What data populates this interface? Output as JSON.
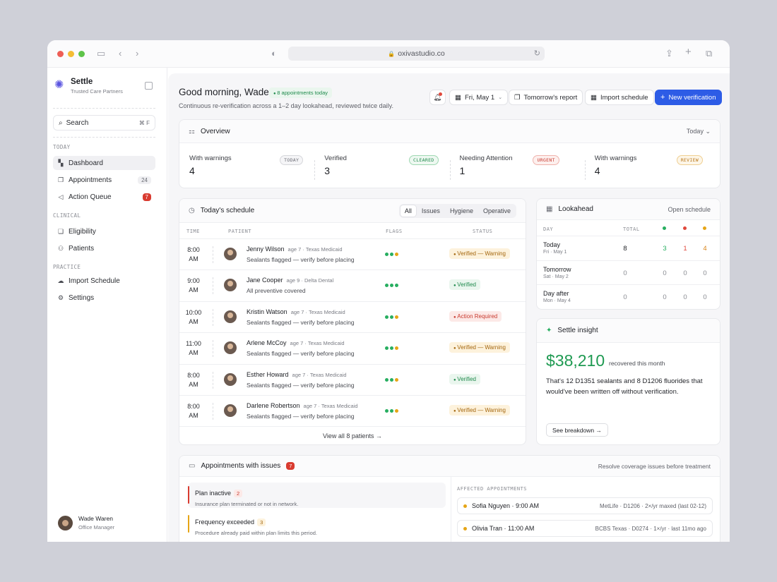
{
  "browser": {
    "url": "oxivastudio.co"
  },
  "sidebar": {
    "brand_name": "Settle",
    "brand_sub": "Trusted Care Partners",
    "search_label": "Search",
    "search_kbd": "⌘ F",
    "sections": {
      "today": "TODAY",
      "clinical": "CLINICAL",
      "practice": "PRACTICE"
    },
    "items": [
      {
        "label": "Dashboard"
      },
      {
        "label": "Appointments",
        "count": "24"
      },
      {
        "label": "Action Queue",
        "count": "7"
      },
      {
        "label": "Eligibility"
      },
      {
        "label": "Patients"
      },
      {
        "label": "Import Schedule"
      },
      {
        "label": "Settings"
      }
    ],
    "user": {
      "name": "Wade Waren",
      "role": "Office Manager"
    }
  },
  "header": {
    "greeting": "Good morning, Wade",
    "badge": "8 appointments today",
    "subtitle": "Continuous re-verification across a 1–2 day lookahead, reviewed twice daily.",
    "date_label": "Fri, May 1",
    "report_label": "Tomorrow's report",
    "import_label": "Import schedule",
    "new_label": "New verification"
  },
  "overview": {
    "title": "Overview",
    "range": "Today",
    "stats": [
      {
        "label": "With warnings",
        "value": "4",
        "tag": "TODAY"
      },
      {
        "label": "Verified",
        "value": "3",
        "tag": "CLEARED"
      },
      {
        "label": "Needing Attention",
        "value": "1",
        "tag": "URGENT"
      },
      {
        "label": "With warnings",
        "value": "4",
        "tag": "REVIEW"
      }
    ]
  },
  "schedule": {
    "title": "Today's schedule",
    "filters": [
      "All",
      "Issues",
      "Hygiene",
      "Operative"
    ],
    "cols": {
      "time": "TIME",
      "patient": "PATIENT",
      "flags": "FLAGS",
      "status": "STATUS"
    },
    "rows": [
      {
        "time": "8:00",
        "ampm": "AM",
        "name": "Jenny Wilson",
        "meta": "age 7 · Texas Medicaid",
        "desc": "Sealants flagged — verify before placing",
        "status": "Verified — Warning"
      },
      {
        "time": "9:00",
        "ampm": "AM",
        "name": "Jane Cooper",
        "meta": "age 9 · Delta Dental",
        "desc": "All preventive covered",
        "status": "Verified"
      },
      {
        "time": "10:00",
        "ampm": "AM",
        "name": "Kristin Watson",
        "meta": "age 7 · Texas Medicaid",
        "desc": "Sealants flagged — verify before placing",
        "status": "Action Required"
      },
      {
        "time": "11:00",
        "ampm": "AM",
        "name": "Arlene McCoy",
        "meta": "age 7 · Texas Medicaid",
        "desc": "Sealants flagged — verify before placing",
        "status": "Verified — Warning"
      },
      {
        "time": "8:00",
        "ampm": "AM",
        "name": "Esther Howard",
        "meta": "age 7 · Texas Medicaid",
        "desc": "Sealants flagged — verify before placing",
        "status": "Verified"
      },
      {
        "time": "8:00",
        "ampm": "AM",
        "name": "Darlene Robertson",
        "meta": "age 7 · Texas Medicaid",
        "desc": "Sealants flagged — verify before placing",
        "status": "Verified — Warning"
      }
    ],
    "view_all": "View all 8 patients →"
  },
  "lookahead": {
    "title": "Lookahead",
    "action": "Open schedule",
    "cols": {
      "day": "DAY",
      "total": "TOTAL"
    },
    "rows": [
      {
        "day": "Today",
        "date": "Fri · May 1",
        "total": "8",
        "green": "3",
        "red": "1",
        "amber": "4"
      },
      {
        "day": "Tomorrow",
        "date": "Sat · May 2",
        "total": "0",
        "green": "0",
        "red": "0",
        "amber": "0"
      },
      {
        "day": "Day after",
        "date": "Mon · May 4",
        "total": "0",
        "green": "0",
        "red": "0",
        "amber": "0"
      }
    ]
  },
  "insight": {
    "title": "Settle insight",
    "amount": "$38,210",
    "amount_sub": "recovered this month",
    "text_pre": "That's ",
    "text_a": "12 D1351 sealants",
    "text_mid": " and ",
    "text_b": "8 D1206 fluorides",
    "text_post": " that would've been written off without verification.",
    "button": "See breakdown →"
  },
  "issues": {
    "title": "Appointments with issues",
    "count": "7",
    "right_text": "Resolve coverage issues before treatment",
    "affected_label": "AFFECTED APPOINTMENTS",
    "items": [
      {
        "title": "Plan inactive",
        "count": "2",
        "desc": "Insurance plan terminated or not in network."
      },
      {
        "title": "Frequency exceeded",
        "count": "3",
        "desc": "Procedure already paid within plan limits this period."
      }
    ],
    "affected": [
      {
        "name": "Sofia Nguyen · 9:00 AM",
        "detail": "MetLife · D1206 · 2×/yr maxed (last 02-12)"
      },
      {
        "name": "Olivia Tran · 11:00 AM",
        "detail": "BCBS Texas · D0274 · 1×/yr · last 11mo ago"
      }
    ]
  },
  "colors": {
    "green": "#27ae60",
    "red": "#e0483c",
    "amber": "#e6a516",
    "primary": "#2d5ce6"
  }
}
